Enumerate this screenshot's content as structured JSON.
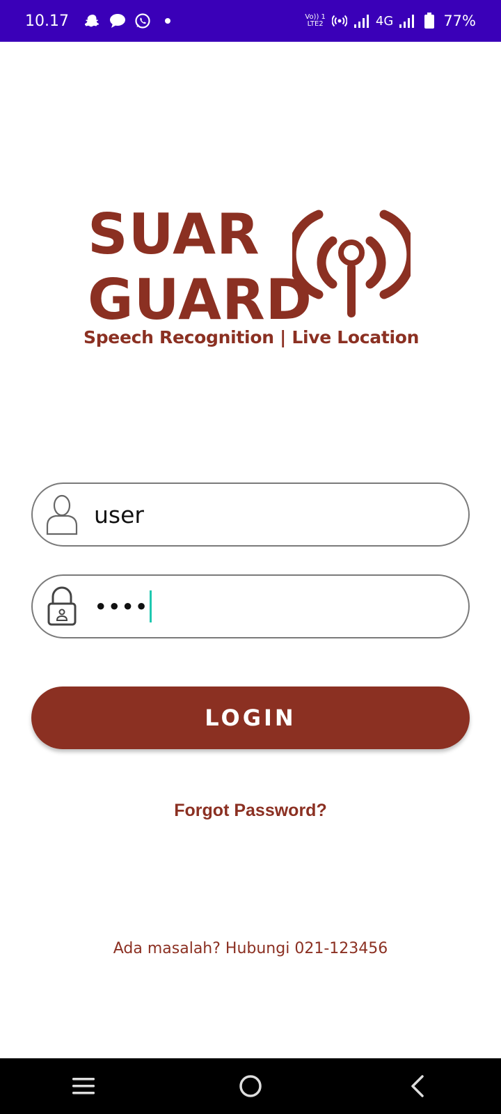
{
  "status_bar": {
    "time": "10.17",
    "left_icons": [
      "snapchat-icon",
      "message-bubble-icon",
      "whatsapp-icon",
      "dot-icon"
    ],
    "volte_top": "Vo)) 1",
    "volte_bottom": "LTE2",
    "network": "4G",
    "battery_percent": "77%"
  },
  "logo": {
    "line1": "SUAR",
    "line2": "GUARD",
    "tagline": "Speech Recognition | Live Location",
    "icon": "broadcast-antenna-icon"
  },
  "form": {
    "username_value": "user",
    "password_value": "••••",
    "username_icon": "user-icon",
    "password_icon": "lock-icon",
    "login_label": "LOGIN",
    "forgot_label": "Forgot Password?",
    "help_text": "Ada masalah? Hubungi 021-123456"
  },
  "nav": {
    "items": [
      "menu-icon",
      "home-circle-icon",
      "back-chevron-icon"
    ]
  },
  "colors": {
    "brand": "#8b3022",
    "status_bar": "#3a00b8",
    "caret": "#1fc8b0"
  }
}
